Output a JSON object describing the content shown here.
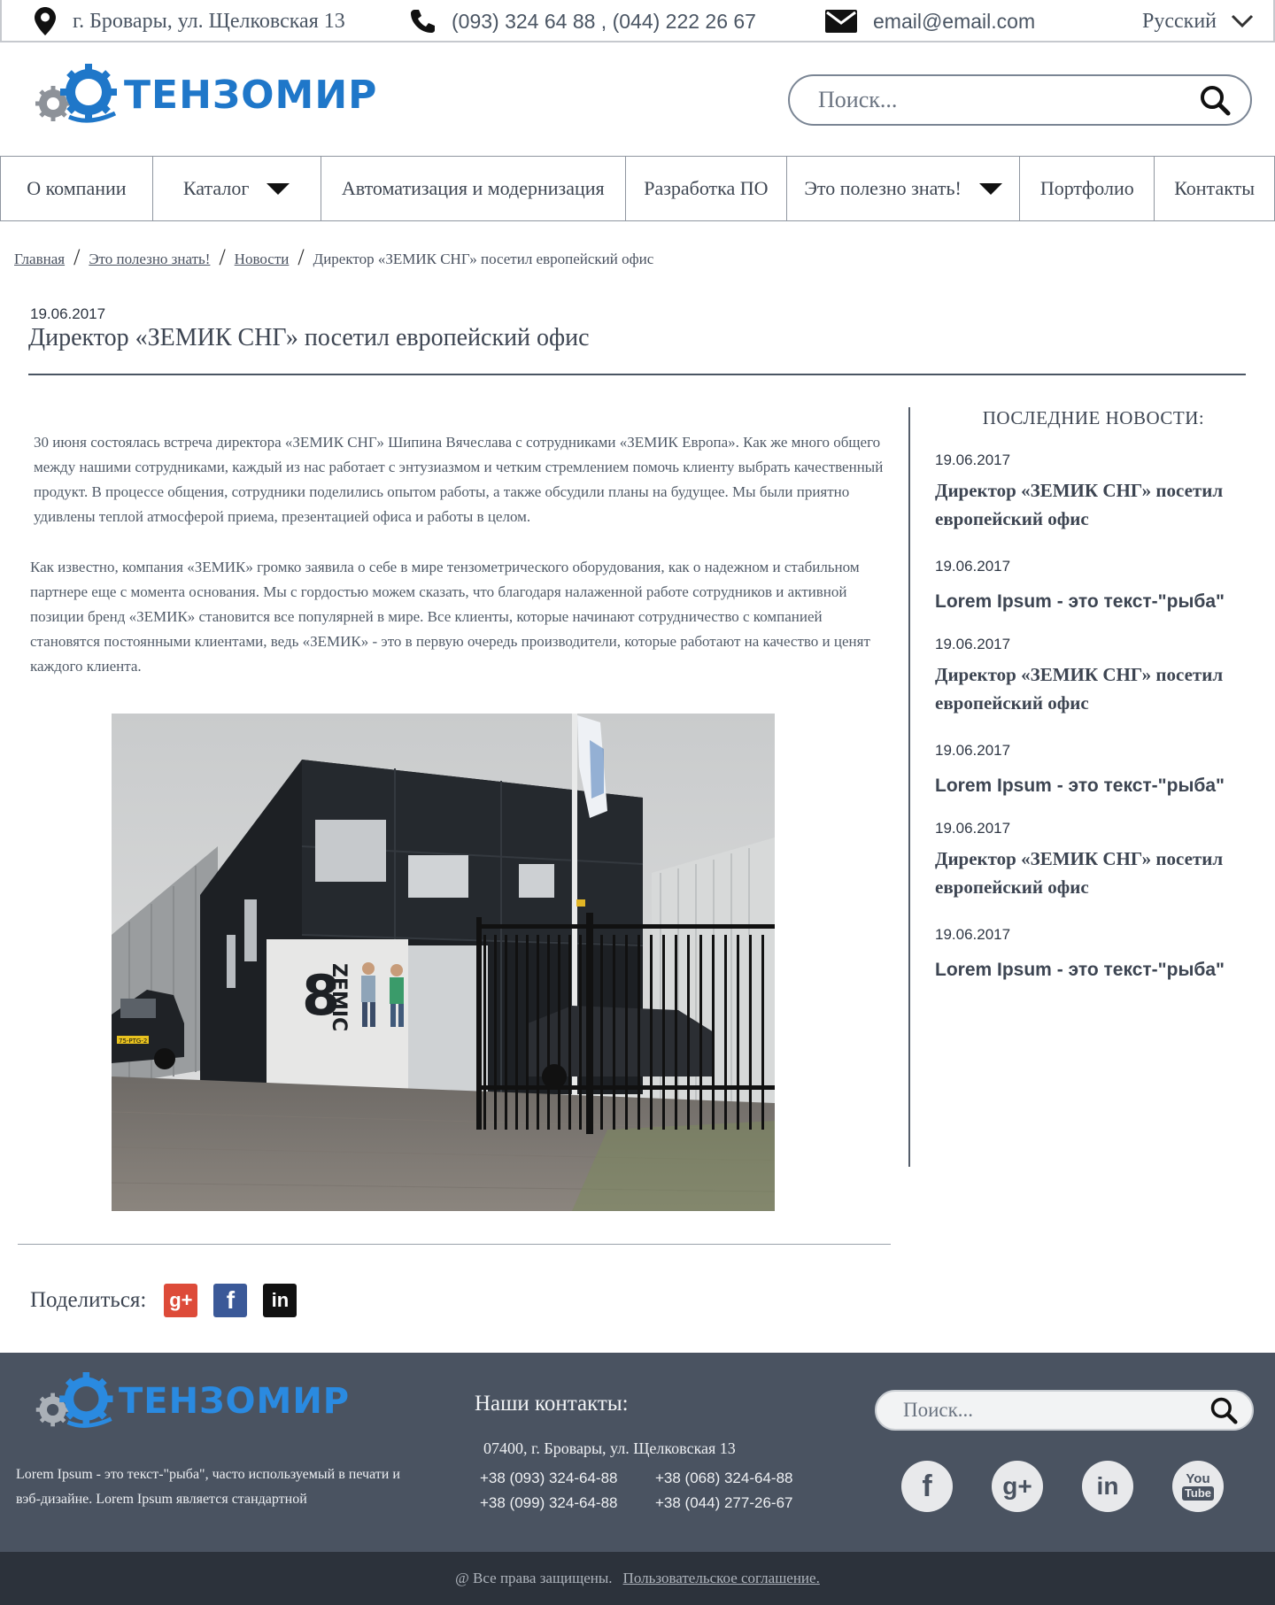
{
  "topbar": {
    "address": "г. Бровары, ул. Щелковская 13",
    "phones": "(093) 324 64 88 , (044) 222 26 67",
    "email": "email@email.com",
    "language": "Русский"
  },
  "header": {
    "logo_text": "ТЕНЗОМИР",
    "search_placeholder": "Поиск..."
  },
  "nav": {
    "items": [
      {
        "label": "О компании"
      },
      {
        "label": "Каталог"
      },
      {
        "label": "Автоматизация и модернизация"
      },
      {
        "label": "Разработка ПО"
      },
      {
        "label": "Это полезно знать!"
      },
      {
        "label": "Портфолио"
      },
      {
        "label": "Контакты"
      }
    ]
  },
  "breadcrumb": {
    "items": [
      "Главная",
      "Это полезно знать!",
      "Новости"
    ],
    "current": "Директор «ЗЕМИК СНГ» посетил европейский офис"
  },
  "article": {
    "date": "19.06.2017",
    "title": "Директор «ЗЕМИК СНГ» посетил европейский офис",
    "paragraph1": "30 июня состоялась встреча директора «ЗЕМИК СНГ» Шипина Вячеслава с сотрудниками «ЗЕМИК Европа». Как же много общего между нашими сотрудниками, каждый из нас работает с энтузиазмом и четким стремлением помочь клиенту выбрать качественный продукт. В процессе общения, сотрудники поделились опытом работы, а также обсудили планы на будущее. Мы были приятно удивлены теплой атмосферой приема, презентацией офиса и работы в целом.",
    "paragraph2": "Как известно, компания «ЗЕМИК» громко заявила о себе в мире тензометрического оборудования, как о надежном и стабильном партнере еще с момента основания. Мы с гордостью можем сказать, что благодаря налаженной работе сотрудников и активной позиции бренд «ЗЕМИК» становится все популярней в мире. Все клиенты, которые начинают сотрудничество с компанией становятся постоянными клиентами, ведь «ЗЕМИК» - это в первую очередь производители, которые работают на качество и ценят каждого клиента.",
    "photo_sign_number": "8",
    "photo_sign_text": "ZEMIC",
    "photo_plate": "75-PTG-2"
  },
  "sidebar": {
    "heading": "ПОСЛЕДНИЕ НОВОСТИ:",
    "news": [
      {
        "date": "19.06.2017",
        "title": "Директор «ЗЕМИК СНГ» посетил европейский офис"
      },
      {
        "date": "19.06.2017",
        "title": "Lorem Ipsum - это текст-\"рыба\""
      },
      {
        "date": "19.06.2017",
        "title": "Директор «ЗЕМИК СНГ» посетил европейский офис"
      },
      {
        "date": "19.06.2017",
        "title": "Lorem Ipsum - это текст-\"рыба\""
      },
      {
        "date": "19.06.2017",
        "title": "Директор «ЗЕМИК СНГ» посетил европейский офис"
      },
      {
        "date": "19.06.2017",
        "title": "Lorem Ipsum - это текст-\"рыба\""
      }
    ]
  },
  "share": {
    "label": "Поделиться:",
    "buttons": [
      {
        "icon": "google-plus-icon",
        "glyph": "g+",
        "color": "#dd4b39"
      },
      {
        "icon": "facebook-icon",
        "glyph": "f",
        "color": "#3b5998"
      },
      {
        "icon": "linkedin-icon",
        "glyph": "in",
        "color": "#111111"
      }
    ]
  },
  "footer": {
    "logo_text": "ТЕНЗОМИР",
    "about": "Lorem Ipsum - это текст-\"рыба\", часто используемый в печати и вэб-дизайне. Lorem Ipsum является стандартной",
    "contacts_heading": "Наши контакты:",
    "address": "07400, г. Бровары, ул. Щелковская 13",
    "phones": [
      "+38 (093) 324-64-88",
      "+38 (068) 324-64-88",
      "+38 (099) 324-64-88",
      "+38 (044) 277-26-67"
    ],
    "search_placeholder": "Поиск...",
    "social": [
      {
        "icon": "facebook-icon",
        "glyph": "f"
      },
      {
        "icon": "google-plus-icon",
        "glyph": "g+"
      },
      {
        "icon": "linkedin-icon",
        "glyph": "in"
      },
      {
        "icon": "youtube-icon",
        "glyph_top": "You",
        "glyph_bottom": "Tube"
      }
    ],
    "copyright": "@ Все права защищены.",
    "agreement": "Пользовательское соглашение."
  },
  "colors": {
    "brand_blue": "#1f77c9",
    "footer_bg": "#4a5361",
    "footer_bottom_bg": "#2c323b"
  }
}
